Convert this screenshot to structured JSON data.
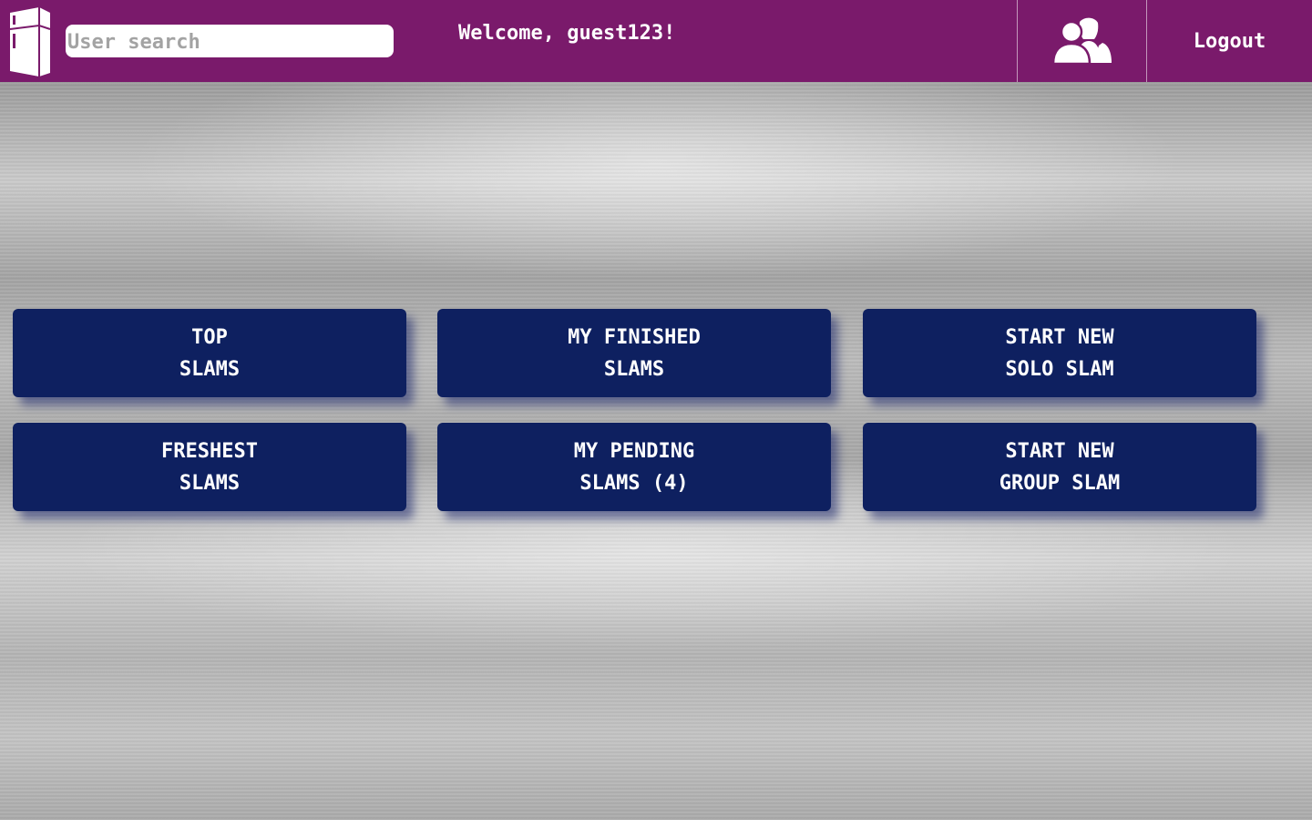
{
  "header": {
    "logo_icon": "fridge-icon",
    "search_placeholder": "User search",
    "search_value": "",
    "welcome_text": "Welcome, guest123!",
    "friends_icon": "users-icon",
    "logout_label": "Logout",
    "bar_color": "#7a1a6b"
  },
  "tiles": [
    {
      "line1": "TOP",
      "line2": "SLAMS"
    },
    {
      "line1": "MY FINISHED",
      "line2": "SLAMS"
    },
    {
      "line1": "START NEW",
      "line2": "SOLO SLAM"
    },
    {
      "line1": "FRESHEST",
      "line2": "SLAMS"
    },
    {
      "line1": "MY PENDING",
      "line2": "SLAMS (4)"
    },
    {
      "line1": "START NEW",
      "line2": "GROUP SLAM"
    }
  ],
  "colors": {
    "tile_bg": "#0e2060",
    "text": "#ffffff"
  }
}
